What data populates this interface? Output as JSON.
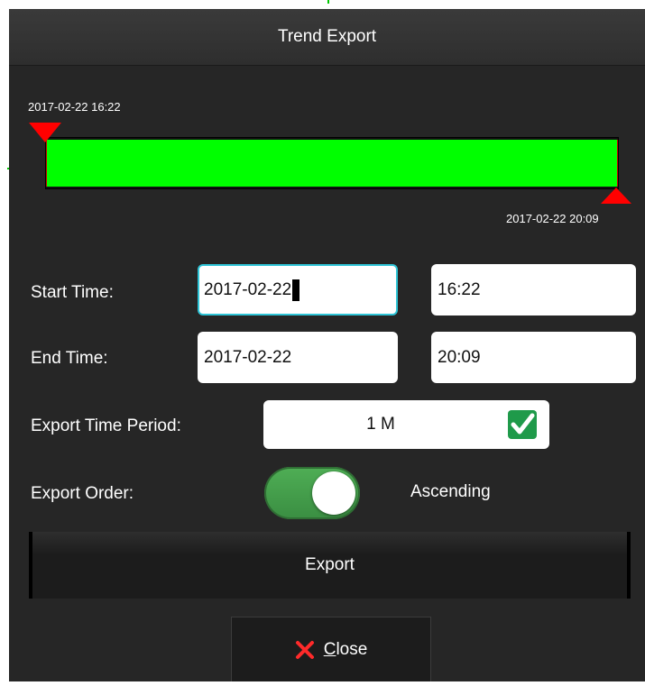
{
  "dialog": {
    "title": "Trend Export"
  },
  "range": {
    "start_label": "2017-02-22 16:22",
    "end_label": "2017-02-22 20:09",
    "fill_fraction_start": 0.0,
    "fill_fraction_end": 1.0
  },
  "start_time": {
    "label": "Start Time:",
    "date": "2017-02-22",
    "time": "16:22"
  },
  "end_time": {
    "label": "End Time:",
    "date": "2017-02-22",
    "time": "20:09"
  },
  "export_period": {
    "label": "Export Time Period:",
    "value": "1 M",
    "checked": true
  },
  "export_order": {
    "label": "Export Order:",
    "value": "Ascending",
    "toggle_on": true
  },
  "buttons": {
    "export": "Export",
    "close": "Close"
  },
  "colors": {
    "range_fill": "#00ff00",
    "marker": "#ff0000",
    "toggle": "#4fae55",
    "focus": "#2ec4d6",
    "checkbox": "#1f9a4a"
  }
}
